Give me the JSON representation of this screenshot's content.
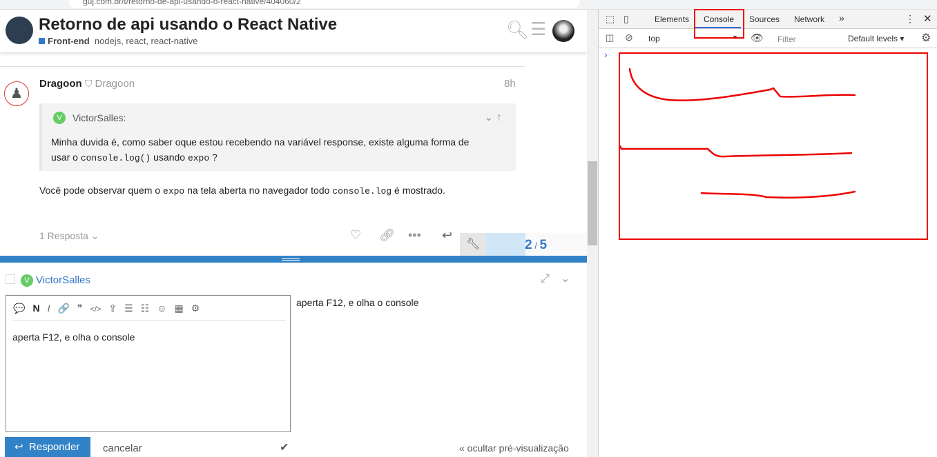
{
  "browser": {
    "url": "guj.com.br/t/retorno-de-api-usando-o-react-native/404060/2"
  },
  "topic": {
    "title": "Retorno de api usando o React Native",
    "category": "Front-end",
    "tags": "nodejs, react, react-native"
  },
  "post": {
    "username": "Dragoon",
    "name": "Dragoon",
    "time": "8h",
    "quote_author": "VictorSalles:",
    "quote_avatar_letter": "V",
    "quote_line1": "Minha duvida é, como saber oque estou recebendo na variável response, existe alguma forma de",
    "quote_l2a": "usar o ",
    "quote_code1": "console.log()",
    "quote_l2b": " usando ",
    "quote_code2": "expo",
    "quote_l2c": " ?",
    "body_a": "Você pode observar quem o ",
    "body_code1": "expo",
    "body_b": " na tela aberta no navegador todo ",
    "body_code2": "console.log",
    "body_c": " é mostrado.",
    "replies": "1 Resposta"
  },
  "progress": {
    "current": "2",
    "sep": "/",
    "total": "5"
  },
  "composer": {
    "reply_to": "VictorSalles",
    "avatar_letter": "V",
    "text": "aperta F12, e olha o console",
    "preview": "aperta F12, e olha o console",
    "submit": "Responder",
    "cancel": "cancelar",
    "hide_preview": "« ocultar pré-visualização",
    "toolbar": [
      "💬",
      "N",
      "I",
      "🔗",
      "❞",
      "</>",
      "⇪",
      "☰",
      "☷",
      "☺",
      "▦",
      "⚙"
    ]
  },
  "devtools": {
    "tabs": [
      "Elements",
      "Console",
      "Sources",
      "Network"
    ],
    "more": "»",
    "context": "top",
    "filter_placeholder": "Filter",
    "levels": "Default levels ▾",
    "prompt": "›"
  },
  "colors": {
    "accent": "#3282c8",
    "annotation": "#e00000"
  }
}
